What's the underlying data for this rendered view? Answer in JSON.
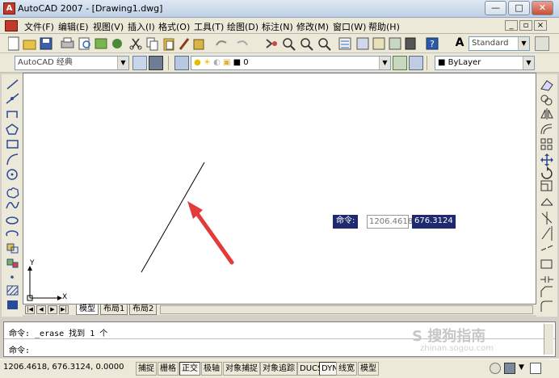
{
  "window": {
    "title": "AutoCAD 2007 - [Drawing1.dwg]",
    "app_icon": "autocad-logo-icon"
  },
  "window_controls": {
    "minimize": "—",
    "restore": "□",
    "close": "✕"
  },
  "doc_controls": {
    "minimize": "_",
    "restore": "▫",
    "close": "×"
  },
  "menu": {
    "items": [
      "文件(F)",
      "编辑(E)",
      "视图(V)",
      "插入(I)",
      "格式(O)",
      "工具(T)",
      "绘图(D)",
      "标注(N)",
      "修改(M)",
      "窗口(W)",
      "帮助(H)"
    ]
  },
  "toolbar_properties": {
    "text_style": "Standard",
    "workspace": "AutoCAD 经典",
    "layer": "0",
    "color": "ByLayer"
  },
  "layout_tabs": {
    "tabs": [
      "模型",
      "布局1",
      "布局2"
    ],
    "active": "模型"
  },
  "ucs": {
    "x_label": "X",
    "y_label": "Y"
  },
  "dynamic_input": {
    "label": "命令:",
    "x_value": "1206.4618",
    "y_value": "676.3124"
  },
  "command_window": {
    "line1": "命令: _erase 找到 1 个",
    "line2": "命令:"
  },
  "statusbar": {
    "coordinates": "1206.4618,  676.3124,  0.0000",
    "toggles": [
      {
        "label": "捕捉",
        "on": false
      },
      {
        "label": "栅格",
        "on": false
      },
      {
        "label": "正交",
        "on": true
      },
      {
        "label": "极轴",
        "on": false
      },
      {
        "label": "对象捕捉",
        "on": false
      },
      {
        "label": "对象追踪",
        "on": false
      },
      {
        "label": "DUCS",
        "on": false
      },
      {
        "label": "DYN",
        "on": true
      },
      {
        "label": "线宽",
        "on": false
      },
      {
        "label": "模型",
        "on": false
      }
    ]
  },
  "watermark": {
    "text": "zhinan.sogou.com"
  },
  "colors": {
    "annotation_arrow": "#e23b3b",
    "dyn_bg": "#1f2a6e",
    "window_bg": "#ece9d8"
  }
}
